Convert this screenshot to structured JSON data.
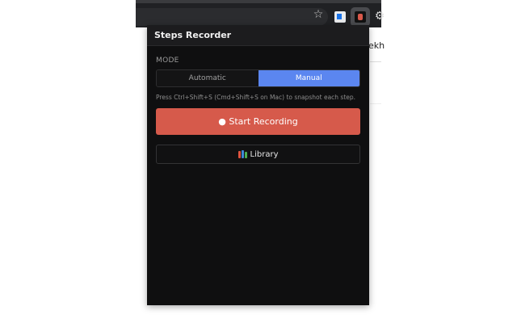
{
  "popup": {
    "title": "Steps Recorder",
    "mode_label": "MODE",
    "modes": [
      {
        "label": "Automatic",
        "active": false
      },
      {
        "label": "Manual",
        "active": true
      }
    ],
    "hint": "Press Ctrl+Shift+S (Cmd+Shift+S on Mac) to snapshot each step.",
    "start_button": "● Start Recording",
    "library_button": "Library",
    "library_icon": "books-icon"
  },
  "background": {
    "partial_text": "ekh"
  },
  "colors": {
    "accent_blue": "#5b86f0",
    "record_red": "#d65a4b",
    "popup_bg": "#0f0f10"
  },
  "toolbar_icons": [
    "star-icon",
    "extension-icon",
    "steps-recorder-extension-icon",
    "puzzle-icon"
  ]
}
